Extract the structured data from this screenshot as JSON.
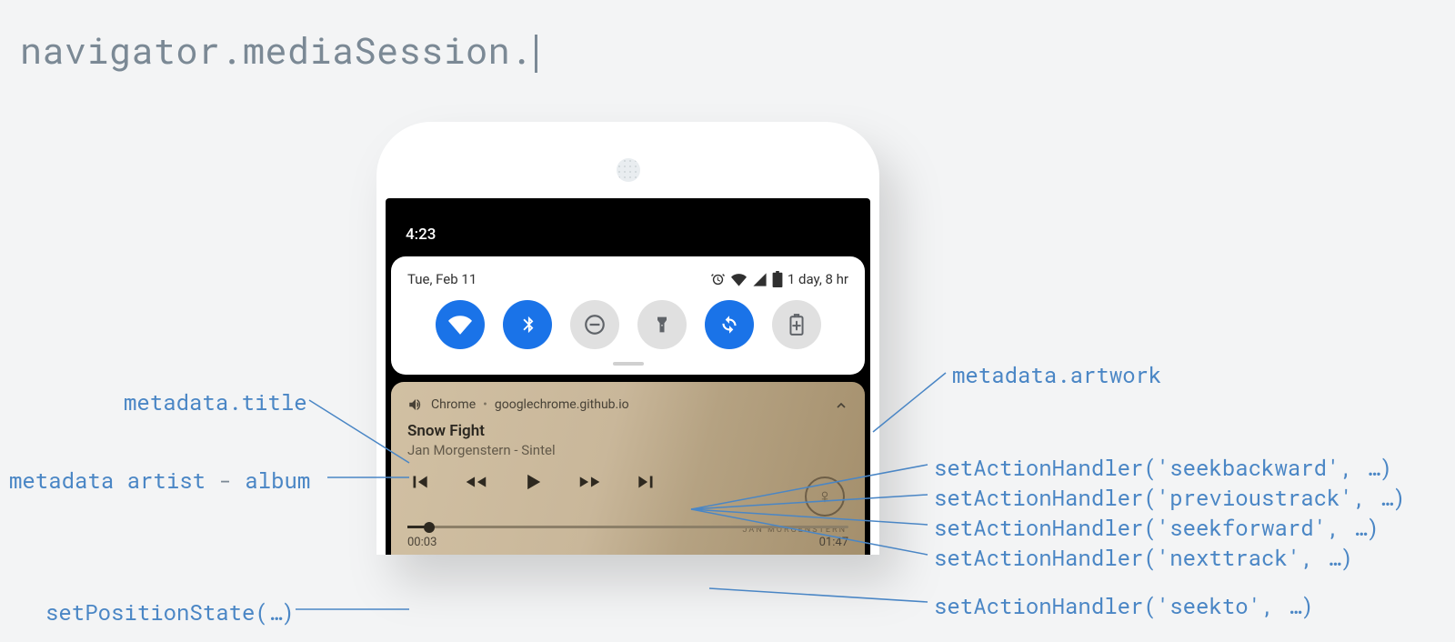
{
  "header": {
    "code": "navigator.mediaSession."
  },
  "phone": {
    "clock": "4:23",
    "date": "Tue, Feb 11",
    "battery_text": "1 day, 8 hr",
    "qs": [
      {
        "name": "wifi",
        "on": true
      },
      {
        "name": "bluetooth",
        "on": true
      },
      {
        "name": "dnd",
        "on": false
      },
      {
        "name": "flashlight",
        "on": false
      },
      {
        "name": "autorotate",
        "on": true
      },
      {
        "name": "battery-saver",
        "on": false
      }
    ]
  },
  "media": {
    "app": "Chrome",
    "origin": "googlechrome.github.io",
    "title": "Snow Fight",
    "subtitle": "Jan Morgenstern - Sintel",
    "position": "00:03",
    "duration": "01:47",
    "credit": "JAN MORGENSTERN"
  },
  "labels": {
    "title": "metadata.title",
    "artist_pre": "metadata artist",
    "artist_sep": " - ",
    "artist_post": "album",
    "position": "setPositionState(…)",
    "artwork": "metadata.artwork",
    "h_seekback": "setActionHandler('seekbackward', …)",
    "h_prev": "setActionHandler('previoustrack', …)",
    "h_seekfwd": "setActionHandler('seekforward', …)",
    "h_next": "setActionHandler('nexttrack', …)",
    "h_seekto": "setActionHandler('seekto', …)"
  }
}
